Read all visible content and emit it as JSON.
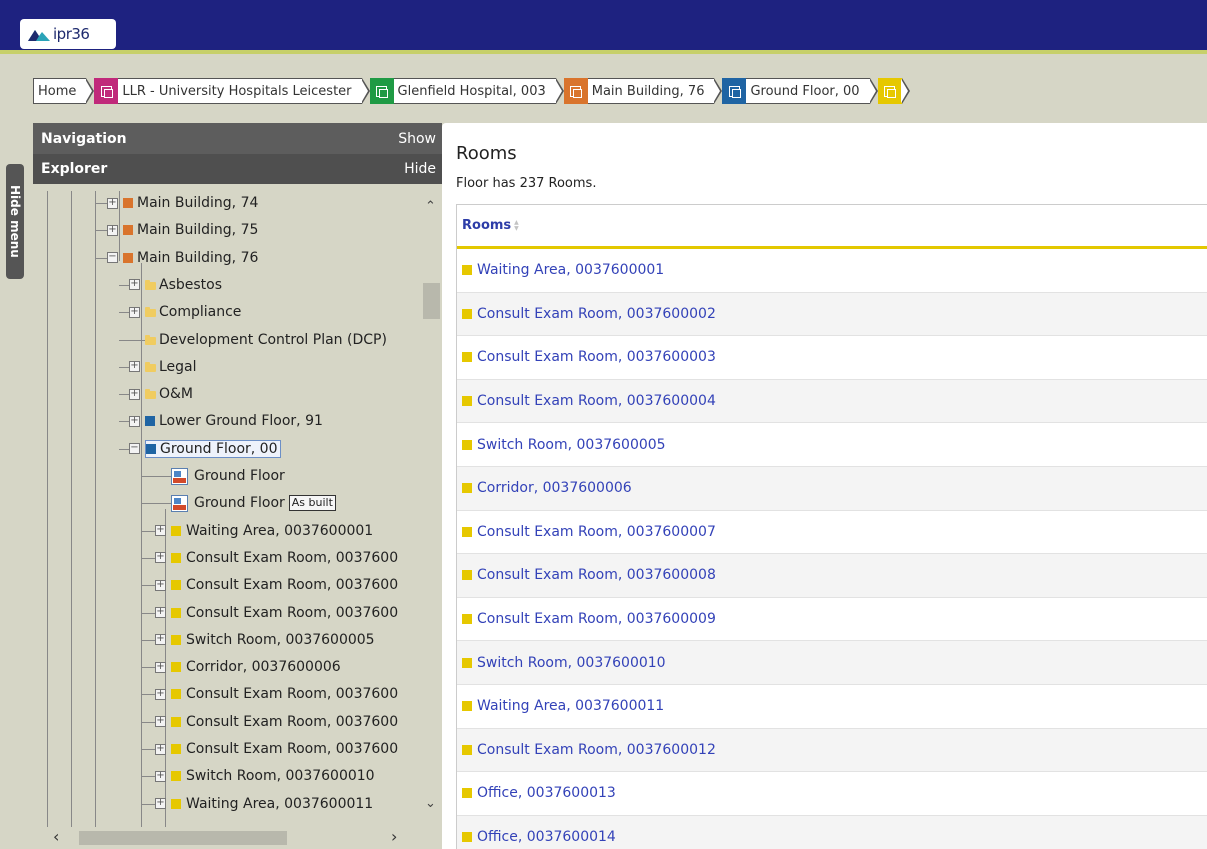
{
  "app": {
    "logo_text": "ipr36"
  },
  "breadcrumb": [
    {
      "label": "Home",
      "icon_color": ""
    },
    {
      "label": "LLR - University Hospitals Leicester",
      "icon_color": "#c0297a"
    },
    {
      "label": "Glenfield Hospital, 003",
      "icon_color": "#1f9a44"
    },
    {
      "label": "Main Building, 76",
      "icon_color": "#d9742c"
    },
    {
      "label": "Ground Floor, 00",
      "icon_color": "#1f64a3"
    },
    {
      "label": "",
      "icon_color": "#e6c800"
    }
  ],
  "navigation": {
    "title": "Navigation",
    "action": "Show"
  },
  "explorer": {
    "title": "Explorer",
    "action": "Hide"
  },
  "hide_menu": "Hide menu",
  "tree": [
    {
      "level": 3,
      "expander": "+",
      "kind": "building",
      "label": "Main Building, 74"
    },
    {
      "level": 3,
      "expander": "+",
      "kind": "building",
      "label": "Main Building, 75"
    },
    {
      "level": 3,
      "expander": "-",
      "kind": "building",
      "label": "Main Building, 76"
    },
    {
      "level": 4,
      "expander": "+",
      "kind": "folder",
      "label": "Asbestos"
    },
    {
      "level": 4,
      "expander": "+",
      "kind": "folder",
      "label": "Compliance"
    },
    {
      "level": 4,
      "expander": "",
      "kind": "folder",
      "label": "Development Control Plan (DCP)"
    },
    {
      "level": 4,
      "expander": "+",
      "kind": "folder",
      "label": "Legal"
    },
    {
      "level": 4,
      "expander": "+",
      "kind": "folder",
      "label": "O&M"
    },
    {
      "level": 4,
      "expander": "+",
      "kind": "floor",
      "label": "Lower Ground Floor, 91"
    },
    {
      "level": 4,
      "expander": "-",
      "kind": "floor",
      "label": "Ground Floor, 00",
      "selected": true
    },
    {
      "level": 5,
      "expander": "",
      "kind": "dwg",
      "label": "Ground Floor"
    },
    {
      "level": 5,
      "expander": "",
      "kind": "dwg",
      "label": "Ground Floor",
      "badge": "As built"
    },
    {
      "level": 5,
      "expander": "+",
      "kind": "room",
      "label": "Waiting Area, 0037600001"
    },
    {
      "level": 5,
      "expander": "+",
      "kind": "room",
      "label": "Consult Exam Room, 0037600"
    },
    {
      "level": 5,
      "expander": "+",
      "kind": "room",
      "label": "Consult Exam Room, 0037600"
    },
    {
      "level": 5,
      "expander": "+",
      "kind": "room",
      "label": "Consult Exam Room, 0037600"
    },
    {
      "level": 5,
      "expander": "+",
      "kind": "room",
      "label": "Switch Room, 0037600005"
    },
    {
      "level": 5,
      "expander": "+",
      "kind": "room",
      "label": "Corridor, 0037600006"
    },
    {
      "level": 5,
      "expander": "+",
      "kind": "room",
      "label": "Consult Exam Room, 0037600"
    },
    {
      "level": 5,
      "expander": "+",
      "kind": "room",
      "label": "Consult Exam Room, 0037600"
    },
    {
      "level": 5,
      "expander": "+",
      "kind": "room",
      "label": "Consult Exam Room, 0037600"
    },
    {
      "level": 5,
      "expander": "+",
      "kind": "room",
      "label": "Switch Room, 0037600010"
    },
    {
      "level": 5,
      "expander": "+",
      "kind": "room",
      "label": "Waiting Area, 0037600011"
    }
  ],
  "rooms_panel": {
    "title": "Rooms",
    "subtitle": "Floor has 237 Rooms.",
    "column_header": "Rooms",
    "rows": [
      "Waiting Area, 0037600001",
      "Consult Exam Room, 0037600002",
      "Consult Exam Room, 0037600003",
      "Consult Exam Room, 0037600004",
      "Switch Room, 0037600005",
      "Corridor, 0037600006",
      "Consult Exam Room, 0037600007",
      "Consult Exam Room, 0037600008",
      "Consult Exam Room, 0037600009",
      "Switch Room, 0037600010",
      "Waiting Area, 0037600011",
      "Consult Exam Room, 0037600012",
      "Office, 0037600013",
      "Office, 0037600014"
    ]
  },
  "colors": {
    "topbar": "#1e2280",
    "accent_line": "#c7d06a",
    "room": "#e6c800",
    "building": "#d9742c",
    "floor": "#1f64a3",
    "link": "#3342b8"
  }
}
